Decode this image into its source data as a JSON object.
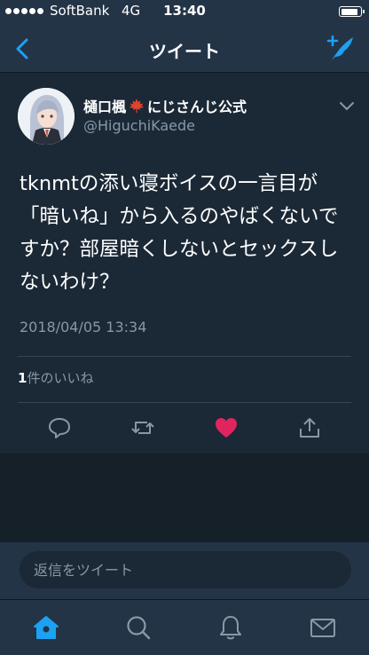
{
  "status_bar": {
    "carrier": "SoftBank",
    "network": "4G",
    "time": "13:40"
  },
  "nav": {
    "title": "ツイート",
    "back_icon": "chevron-left-icon",
    "compose_icon": "compose-feather-icon"
  },
  "tweet": {
    "author": {
      "display_name": "樋口楓",
      "name_suffix": "にじさんじ公式",
      "handle": "@HiguchiKaede"
    },
    "text": "tknmtの添い寝ボイスの一言目が「暗いね」から入るのやばくないですか？部屋暗くしないとセックスしないわけ？",
    "timestamp": "2018/04/05 13:34",
    "likes": {
      "count": "1",
      "label": "件のいいね"
    },
    "actions": [
      "reply-icon",
      "retweet-icon",
      "like-heart-icon",
      "share-icon"
    ]
  },
  "reply": {
    "placeholder": "返信をツイート"
  },
  "tab_bar": {
    "tabs": [
      "home-icon",
      "search-icon",
      "notifications-bell-icon",
      "messages-mail-icon"
    ],
    "active": "home-icon"
  },
  "colors": {
    "background": "#1b2836",
    "bar": "#243447",
    "accent": "#1da1f2",
    "like": "#e0245e",
    "secondary_text": "#8899a6"
  }
}
